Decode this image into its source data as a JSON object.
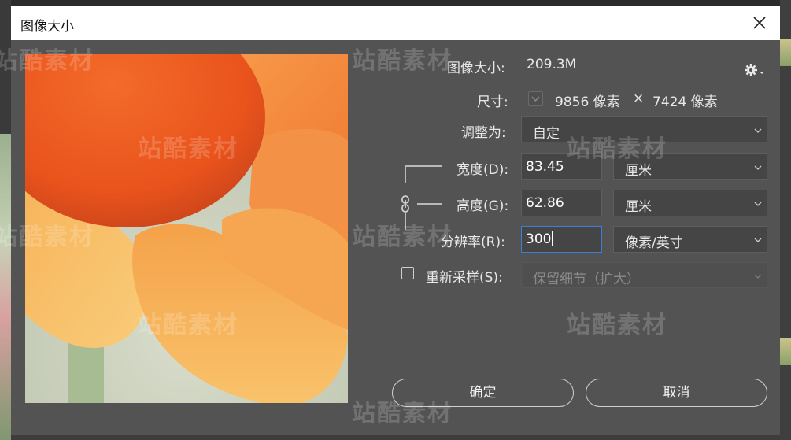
{
  "dialog": {
    "title": "图像大小",
    "close_icon": "close-icon"
  },
  "info": {
    "image_size_label": "图像大小:",
    "image_size_value": "209.3M",
    "dimensions_label": "尺寸:",
    "width_px": "9856 像素",
    "times": "×",
    "height_px": "7424 像素",
    "gear_icon": "gear-icon"
  },
  "fit_to": {
    "label": "调整为:",
    "value": "自定"
  },
  "width": {
    "label": "宽度(D):",
    "value": "83.45",
    "unit": "厘米"
  },
  "height": {
    "label": "高度(G):",
    "value": "62.86",
    "unit": "厘米"
  },
  "resolution": {
    "label": "分辨率(R):",
    "value": "300",
    "unit": "像素/英寸"
  },
  "resample": {
    "label": "重新采样(S):",
    "checked": false,
    "method": "保留细节（扩大）"
  },
  "buttons": {
    "ok": "确定",
    "cancel": "取消"
  },
  "watermark": "站酷素材",
  "colors": {
    "dialog_bg": "#535353",
    "focus_border": "#3d7fd6",
    "petal_orange": "#f0a049",
    "center_orange": "#ee5a1f"
  }
}
